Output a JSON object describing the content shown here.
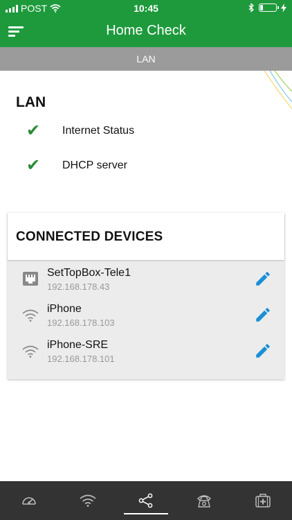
{
  "status_bar": {
    "carrier": "POST",
    "time": "10:45",
    "battery_level": 0.2
  },
  "header": {
    "title": "Home Check"
  },
  "section_tab": {
    "label": "LAN"
  },
  "lan": {
    "title": "LAN",
    "checks": [
      {
        "label": "Internet Status",
        "status": "ok"
      },
      {
        "label": "DHCP server",
        "status": "ok"
      }
    ]
  },
  "devices": {
    "title": "CONNECTED DEVICES",
    "items": [
      {
        "name": "SetTopBox-Tele1",
        "ip": "192.168.178.43",
        "icon": "ethernet-port-icon"
      },
      {
        "name": "iPhone",
        "ip": "192.168.178.103",
        "icon": "wifi-icon"
      },
      {
        "name": "iPhone-SRE",
        "ip": "192.168.178.101",
        "icon": "wifi-icon"
      }
    ]
  },
  "bottom_nav": {
    "items": [
      {
        "icon": "speedometer-icon",
        "active": false
      },
      {
        "icon": "wifi-icon",
        "active": false
      },
      {
        "icon": "network-share-icon",
        "active": true
      },
      {
        "icon": "telephone-icon",
        "active": false
      },
      {
        "icon": "first-aid-kit-icon",
        "active": false
      }
    ]
  },
  "colors": {
    "brand_green": "#1e9a3c",
    "check_green": "#2a8c3a",
    "edit_blue": "#1a8fd6",
    "tab_gray": "#9b9b9b",
    "nav_dark": "#333333"
  }
}
